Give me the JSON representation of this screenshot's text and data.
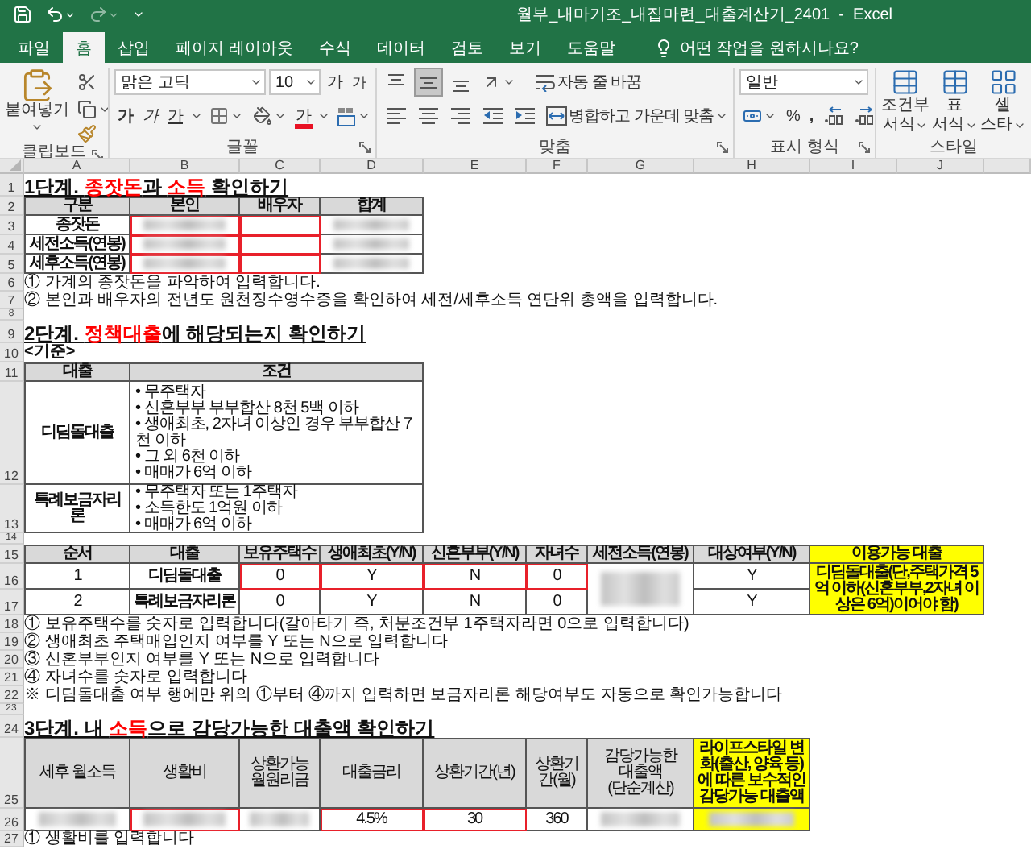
{
  "window": {
    "title": "월부_내마기조_내집마련_대출계산기_2401  -  Excel"
  },
  "tabs": [
    {
      "label": "파일",
      "selected": false
    },
    {
      "label": "홈",
      "selected": true
    },
    {
      "label": "삽입",
      "selected": false
    },
    {
      "label": "페이지 레이아웃",
      "selected": false
    },
    {
      "label": "수식",
      "selected": false
    },
    {
      "label": "데이터",
      "selected": false
    },
    {
      "label": "검토",
      "selected": false
    },
    {
      "label": "보기",
      "selected": false
    },
    {
      "label": "도움말",
      "selected": false
    }
  ],
  "tell_me": "어떤 작업을 원하시나요?",
  "ribbon": {
    "clipboard": {
      "label": "클립보드",
      "paste": "붙여넣기"
    },
    "font": {
      "label": "글꼴",
      "font_name": "맑은 고딕",
      "font_size": "10",
      "grow": "가",
      "shrink": "가",
      "bold": "가",
      "italic": "가",
      "underline": "가",
      "font_color": "가"
    },
    "alignment": {
      "label": "맞춤",
      "vertical_align": [
        {
          "selected": false
        },
        {
          "selected": true
        },
        {
          "selected": false
        }
      ],
      "wrap_text": "자동 줄 바꿈",
      "merge_center": "병합하고 가운데 맞춤"
    },
    "number": {
      "label": "표시 형식",
      "format": "일반",
      "percent": "%",
      "comma": ","
    },
    "styles": {
      "label": "스타일",
      "buttons": [
        {
          "top": "조건부",
          "bottom": "서식"
        },
        {
          "top": "표",
          "bottom": "서식"
        },
        {
          "top": "셀",
          "bottom": "스타"
        }
      ]
    }
  },
  "columns": [
    "A",
    "B",
    "C",
    "D",
    "E",
    "F",
    "G",
    "H",
    "I",
    "J"
  ],
  "row_numbers": [
    "1",
    "2",
    "3",
    "4",
    "5",
    "6",
    "7",
    "8",
    "9",
    "10",
    "11",
    "12",
    "13",
    "14",
    "15",
    "16",
    "17",
    "18",
    "19",
    "20",
    "21",
    "22",
    "23",
    "24",
    "25",
    "26",
    "27"
  ],
  "step1": {
    "title": [
      {
        "text": "1단계. ",
        "highlight": false
      },
      {
        "text": "종잣돈",
        "highlight": true
      },
      {
        "text": "과 ",
        "highlight": false
      },
      {
        "text": "소득",
        "highlight": true
      },
      {
        "text": " 확인하기",
        "highlight": false
      }
    ],
    "headers": [
      "구분",
      "본인",
      "배우자",
      "합계"
    ],
    "rows": [
      {
        "label": "종잣돈",
        "cells": [
          {
            "blurred": true,
            "input": true
          },
          {
            "blurred": false,
            "input": true
          },
          {
            "blurred": true,
            "input": false
          }
        ]
      },
      {
        "label": "세전소득(연봉)",
        "cells": [
          {
            "blurred": true,
            "input": true
          },
          {
            "blurred": false,
            "input": true
          },
          {
            "blurred": true,
            "input": false
          }
        ]
      },
      {
        "label": "세후소득(연봉)",
        "cells": [
          {
            "blurred": true,
            "input": true
          },
          {
            "blurred": false,
            "input": true
          },
          {
            "blurred": true,
            "input": false
          }
        ]
      }
    ],
    "notes": [
      "① 가계의 종잣돈을 파악하여 입력합니다.",
      "② 본인과 배우자의 전년도 원천징수영수증을 확인하여 세전/세후소득 연단위 총액을 입력합니다."
    ]
  },
  "step2": {
    "title": [
      {
        "text": "2단계. ",
        "highlight": false
      },
      {
        "text": "정책대출",
        "highlight": true
      },
      {
        "text": "에 해당되는지 확인하기",
        "highlight": false
      }
    ],
    "subheading": "<기준>",
    "criteria": {
      "headers": [
        "대출",
        "조건"
      ],
      "rows": [
        {
          "loan": "디딤돌대출",
          "conditions": [
            "• 무주택자",
            "• 신혼부부 부부합산 8천 5백 이하",
            "• 생애최초, 2자녀 이상인 경우 부부합산 7천 이하",
            "• 그 외 6천 이하",
            "• 매매가 6억 이하"
          ]
        },
        {
          "loan": "특례보금자리론",
          "conditions": [
            "• 무주택자 또는 1주택자",
            "• 소득한도 1억원 이하",
            "• 매매가 6억 이하"
          ]
        }
      ]
    },
    "check": {
      "headers": [
        {
          "label": "순서",
          "highlight": false
        },
        {
          "label": "대출",
          "highlight": false
        },
        {
          "label": "보유주택수",
          "highlight": false
        },
        {
          "label": "생애최초(Y/N)",
          "highlight": false
        },
        {
          "label": "신혼부부(Y/N)",
          "highlight": false
        },
        {
          "label": "자녀수",
          "highlight": false
        },
        {
          "label": "세전소득(연봉)",
          "highlight": false
        },
        {
          "label": "대상여부(Y/N)",
          "highlight": false
        },
        {
          "label": "이용가능 대출",
          "highlight": true
        }
      ],
      "rows": [
        {
          "order": "1",
          "loan": "디딤돌대출",
          "cells": [
            {
              "value": "0",
              "blurred": false,
              "input": true
            },
            {
              "value": "Y",
              "blurred": false,
              "input": true
            },
            {
              "value": "N",
              "blurred": false,
              "input": true
            },
            {
              "value": "0",
              "blurred": false,
              "input": true
            }
          ],
          "eligible": "Y"
        },
        {
          "order": "2",
          "loan": "특례보금자리론",
          "cells": [
            {
              "value": "0",
              "blurred": false,
              "input": false
            },
            {
              "value": "Y",
              "blurred": false,
              "input": false
            },
            {
              "value": "N",
              "blurred": false,
              "input": false
            },
            {
              "value": "0",
              "blurred": false,
              "input": false
            }
          ],
          "eligible": "Y"
        }
      ],
      "income": {
        "blurred": true,
        "input": false
      },
      "result": "디딤돌대출(단,주택가격 5억 이하(신혼부부,2자녀 이상은 6억)이어야 함)"
    },
    "notes": [
      "① 보유주택수를 숫자로 입력합니다(갈아타기 즉, 처분조건부 1주택자라면 0으로 입력합니다)",
      "② 생애최초 주택매입인지 여부를 Y 또는 N으로 입력합니다",
      "③ 신혼부부인지 여부를 Y 또는 N으로 입력합니다",
      "④ 자녀수를 숫자로 입력합니다",
      "※ 디딤돌대출 여부 행에만 위의 ①부터 ④까지 입력하면 보금자리론 해당여부도 자동으로 확인가능합니다"
    ]
  },
  "step3": {
    "title": [
      {
        "text": "3단계. 내 ",
        "highlight": false
      },
      {
        "text": "소득",
        "highlight": true
      },
      {
        "text": "으로 감당가능한 대출액 확인하기",
        "highlight": false
      }
    ],
    "headers": [
      {
        "label": "세후 월소득",
        "highlight": false
      },
      {
        "label": "생활비",
        "highlight": false
      },
      {
        "label": "상환가능\n월원리금",
        "highlight": false
      },
      {
        "label": "대출금리",
        "highlight": false
      },
      {
        "label": "상환기간(년)",
        "highlight": false
      },
      {
        "label": "상환기간(월)",
        "highlight": false
      },
      {
        "label": "감당가능한\n대출액\n(단순계산)",
        "highlight": false
      },
      {
        "label": "라이프스타일 변화(출산, 양육 등)에 따른 보수적인\n감당가능 대출액",
        "highlight": true
      }
    ],
    "cells": [
      {
        "blurred": true,
        "input": false
      },
      {
        "blurred": true,
        "input": true
      },
      {
        "blurred": true,
        "input": false
      },
      {
        "value": "4.5%",
        "blurred": false,
        "input": true
      },
      {
        "value": "30",
        "blurred": false,
        "input": true
      },
      {
        "value": "360",
        "blurred": false,
        "input": false
      },
      {
        "blurred": true,
        "input": false
      },
      {
        "blurred": true,
        "input": false
      }
    ],
    "notes": [
      "① 생활비를 입력합니다"
    ]
  }
}
